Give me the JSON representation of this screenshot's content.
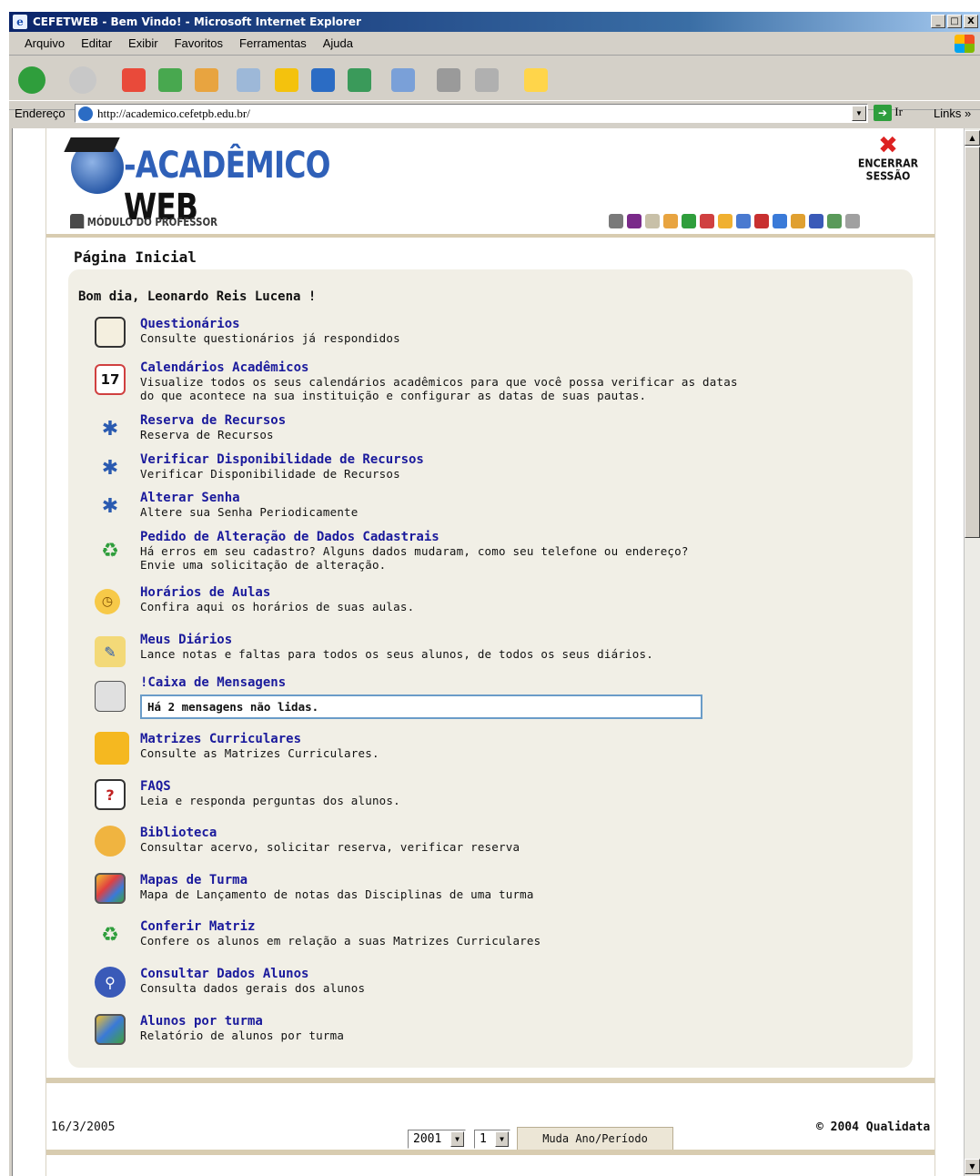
{
  "window": {
    "title": "CEFETWEB - Bem Vindo! - Microsoft Internet Explorer",
    "buttons": [
      "_",
      "□",
      "X"
    ]
  },
  "menu": [
    "Arquivo",
    "Editar",
    "Exibir",
    "Favoritos",
    "Ferramentas",
    "Ajuda"
  ],
  "address": {
    "label": "Endereço",
    "url": "http://academico.cefetpb.edu.br/",
    "go_label": "Ir",
    "links_label": "Links »"
  },
  "header": {
    "logo_part1": "-ACADÊMICO",
    "logo_part2": " WEB",
    "logout_line1": "ENCERRAR",
    "logout_line2": "SESSÃO",
    "module": "MÓDULO DO PROFESSOR"
  },
  "page_title": "Página Inicial",
  "greeting": "Bom dia, Leonardo Reis Lucena !",
  "items": [
    {
      "title": "Questionários",
      "desc": "Consulte questionários já respondidos"
    },
    {
      "title": "Calendários Acadêmicos",
      "desc": "Visualize todos os seus calendários acadêmicos para que você possa verificar as datas\ndo que acontece na sua instituição e configurar as datas de suas pautas."
    },
    {
      "title": "Reserva de Recursos",
      "desc": "Reserva de Recursos"
    },
    {
      "title": "Verificar Disponibilidade de Recursos",
      "desc": "Verificar Disponibilidade de Recursos"
    },
    {
      "title": "Alterar Senha",
      "desc": "Altere sua Senha Periodicamente"
    },
    {
      "title": "Pedido de Alteração de Dados Cadastrais",
      "desc": "Há erros em seu cadastro? Alguns dados mudaram, como seu telefone ou endereço?\nEnvie uma solicitação de alteração."
    },
    {
      "title": "Horários de Aulas",
      "desc": "Confira aqui os horários de suas aulas."
    },
    {
      "title": "Meus Diários",
      "desc": "Lance notas e faltas para todos os seus alunos, de todos os seus diários."
    },
    {
      "title": "!Caixa de Mensagens",
      "desc": ""
    },
    {
      "title": "Matrizes Curriculares",
      "desc": "Consulte as Matrizes Curriculares."
    },
    {
      "title": "FAQS",
      "desc": "Leia e responda perguntas dos alunos."
    },
    {
      "title": "Biblioteca",
      "desc": "Consultar acervo, solicitar reserva, verificar reserva"
    },
    {
      "title": "Mapas de Turma",
      "desc": "Mapa de Lançamento de notas das Disciplinas de uma turma"
    },
    {
      "title": "Conferir Matriz",
      "desc": "Confere os alunos em relação a suas Matrizes Curriculares"
    },
    {
      "title": "Consultar Dados Alunos",
      "desc": "Consulta dados gerais dos alunos"
    },
    {
      "title": "Alunos por turma",
      "desc": "Relatório de alunos por turma"
    }
  ],
  "messages_notice": "Há 2 mensagens não lidas.",
  "footer": {
    "date": "16/3/2005",
    "year_value": "2001",
    "period_value": "1",
    "change_button": "Muda Ano/Período",
    "copyright": "© 2004 Qualidata"
  },
  "colors": {
    "link": "#1a1a9c",
    "accent": "#d8ccb0",
    "panel": "#f1efe6"
  }
}
